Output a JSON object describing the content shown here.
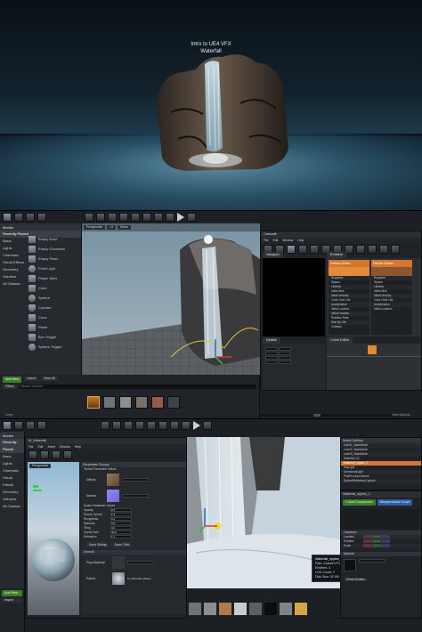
{
  "hero": {
    "title_line1": "Intro to UE4 VFX",
    "title_line2": "Waterfall"
  },
  "editor1": {
    "toolbar": [
      "Save",
      "Source",
      "Content",
      "Marketplace",
      "Settings",
      "Blueprints",
      "Cinematics",
      "Build",
      "Play",
      "Launch"
    ],
    "modes_header": "Modes",
    "search_placeholder": "Search Classes",
    "categories": [
      "Recently Placed",
      "Basic",
      "Lights",
      "Cinematic",
      "Visual Effects",
      "Geometry",
      "Volumes",
      "All Classes"
    ],
    "place_items": [
      "Empty Actor",
      "Empty Character",
      "Empty Pawn",
      "Point Light",
      "Player Start",
      "Cube",
      "Sphere",
      "Cylinder",
      "Cone",
      "Plane",
      "Box Trigger",
      "Sphere Trigger"
    ],
    "viewport_chips": [
      "Perspective",
      "Lit",
      "Show"
    ],
    "cascade_title": "Cascade",
    "cascade_menu": [
      "File",
      "Edit",
      "Window",
      "Help"
    ],
    "cascade_toolbar": [
      "Save",
      "Find in CB",
      "Restart Sim",
      "Restart Level",
      "Undo",
      "Redo",
      "Thumbnail",
      "Bounds",
      "Origin Axis",
      "Background Color",
      "Regen LOD",
      "Lowest LOD",
      "Lower LOD",
      "Add LOD",
      "Higher LOD",
      "Highest LOD"
    ],
    "viewport_tab": "Viewport",
    "emitters_tab": "Emitters",
    "details_tab": "Details",
    "curve_tab": "Curve Editor",
    "emitter_name": "Particle Emitter",
    "modules": [
      "Required",
      "Spawn",
      "Lifetime",
      "Initial Size",
      "Initial Velocity",
      "Color Over Life",
      "Acceleration",
      "Initial Location",
      "Initial Rotation",
      "Rotation Rate",
      "Size By Life",
      "Collision"
    ],
    "add_new": "Add New",
    "import": "Import",
    "save_all": "Save All",
    "filters": "Filters",
    "search_content": "Search Content",
    "content_label": "Content",
    "status_left": "Level",
    "status_right": "View Options"
  },
  "editor2": {
    "toolbar": [
      "Save",
      "Source",
      "Content",
      "Marketplace",
      "Settings",
      "Blueprints",
      "Cinematics",
      "Build",
      "Play",
      "Launch"
    ],
    "modes_header": "Modes",
    "categories": [
      "Recently Placed",
      "Basic",
      "Lights",
      "Cinematic",
      "Visual Effects",
      "Geometry",
      "Volumes",
      "All Classes"
    ],
    "material_title": "M_Waterfall",
    "material_menu": [
      "File",
      "Edit",
      "Asset",
      "Window",
      "Help"
    ],
    "material_toolbar": [
      "Save",
      "Browse",
      "Params",
      "Platforms"
    ],
    "preview_chip": "Perspective",
    "params_header": "Parameter Groups",
    "param_group1": "Texture Parameter Values",
    "params_tex": [
      "Diffuse",
      "Normal"
    ],
    "param_group2": "Scalar Parameter Values",
    "params_scalar": [
      "Opacity",
      "Panner Speed",
      "Roughness",
      "Specular",
      "Tiling",
      "Depth Fade",
      "Refraction"
    ],
    "param_values": [
      "0.8",
      "1.5",
      "0.2",
      "0.5",
      "4.0",
      "30.0",
      "1.1"
    ],
    "save_sibling": "Save Sibling",
    "save_child": "Save Child",
    "general_header": "General",
    "phys_label": "Phys Material",
    "parent_label": "Parent",
    "parent_value": "M_Waterfall_Master",
    "tooltip_title": "Waterfall_ripples_2 (Particle System)",
    "tooltip_lines": [
      "Path: /Game/VFX/Waterfall",
      "Emitters: 4",
      "LOD Count: 1",
      "Disk Size: 52 KB"
    ],
    "world_outliner": "World Outliner",
    "outliner_items": [
      "rock01_StaticMesh",
      "rock02_StaticMesh",
      "rock03_StaticMesh",
      "Waterfall_01",
      "Waterfall_ripples_2",
      "SkyLight",
      "DirectionalLight",
      "PostProcessVolume",
      "SphereReflectionCapture"
    ],
    "details_name": "Waterfall_ripples_2",
    "add_component": "+ Add Component",
    "blueprint_script": "Blueprint/Add Script",
    "transform": "Transform",
    "location": "Location",
    "rotation": "Rotation",
    "scale": "Scale",
    "material_label": "Material",
    "reset_label": "Reset Emitter",
    "add_new": "Add New",
    "import": "Import"
  }
}
